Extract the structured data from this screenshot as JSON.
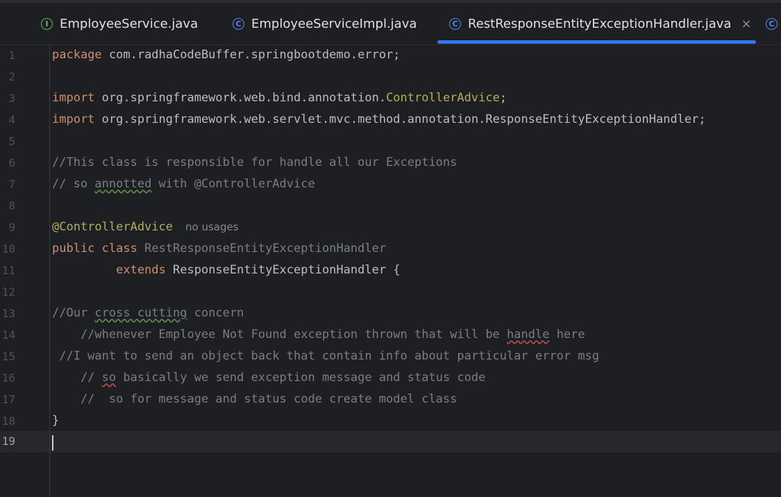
{
  "tabs": [
    {
      "label": "EmployeeService.java",
      "icon": "interface-icon",
      "glyph": "I"
    },
    {
      "label": "EmployeeServiceImpl.java",
      "icon": "class-icon",
      "glyph": "C"
    },
    {
      "label": "RestResponseEntityExceptionHandler.java",
      "icon": "class-icon",
      "glyph": "C",
      "active": true,
      "close": "×"
    },
    {
      "glyph": "C",
      "icon": "class-icon"
    }
  ],
  "editor": {
    "line_numbers": [
      "1",
      "2",
      "3",
      "4",
      "5",
      "6",
      "7",
      "8",
      "9",
      "10",
      "11",
      "12",
      "13",
      "14",
      "15",
      "16",
      "17",
      "18",
      "19"
    ],
    "current_line": "19",
    "lines": {
      "l1": {
        "kw": "package",
        "rest": " com.radhaCodeBuffer.springbootdemo.error;"
      },
      "l3": {
        "kw": "import",
        "rest": " org.springframework.web.bind.annotation.",
        "ann": "ControllerAdvice",
        "end": ";"
      },
      "l4": {
        "kw": "import",
        "rest": " org.springframework.web.servlet.mvc.method.annotation.ResponseEntityExceptionHandler;"
      },
      "l6": {
        "text": "//This class is responsible for handle all our Exceptions"
      },
      "l7": {
        "pre": "// so ",
        "typo": "annotted",
        "post": " with @ControllerAdvice"
      },
      "l9": {
        "ann": "@ControllerAdvice",
        "hint": "no usages"
      },
      "l10": {
        "kw1": "public",
        "kw2": "class",
        "cls": "RestResponseEntityExceptionHandler"
      },
      "l11": {
        "indent": "         ",
        "kw": "extends",
        "rest": " ResponseEntityExceptionHandler {"
      },
      "l13": {
        "pre": "//Our ",
        "typo": "cross cutting",
        "post": " concern"
      },
      "l14": {
        "pre": "    //whenever Employee Not Found exception thrown that will be ",
        "typo": "handle",
        "post": " here"
      },
      "l15": {
        "text": " //I want to send an object back that contain info about particular error msg"
      },
      "l16": {
        "pre": "    // ",
        "typo": "so",
        "post": " basically we send exception message and status code"
      },
      "l17": {
        "text": "    //  so for message and status code create model class"
      },
      "l18": {
        "text": "}"
      }
    }
  },
  "colors": {
    "background": "#1e1f22",
    "keyword": "#cf8e6d",
    "annotation": "#b3ae60",
    "comment": "#7a7e85",
    "text": "#bcbec4",
    "accent": "#3574f0"
  }
}
